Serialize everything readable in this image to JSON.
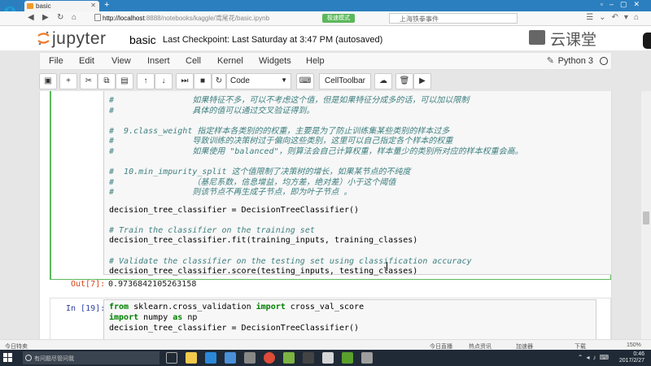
{
  "browser": {
    "tab_title": "basic",
    "url_host": "http://localhost",
    "url_path": ":8888/notebooks/kaggle/鸢尾花/basic.ipynb",
    "speed_badge": "极速模式",
    "search_placeholder": "上海铁拳事件"
  },
  "jupyter": {
    "logo_text": "jupyter",
    "notebook_name": "basic",
    "checkpoint": "Last Checkpoint: Last Saturday at 3:47 PM (autosaved)",
    "brand": "云课堂",
    "menu": [
      "File",
      "Edit",
      "View",
      "Insert",
      "Cell",
      "Kernel",
      "Widgets",
      "Help"
    ],
    "kernel_name": "Python 3",
    "cell_type": "Code",
    "celltoolbar": "CellToolbar"
  },
  "cell1": {
    "lines": [
      {
        "cls": "cm",
        "text": "#                如果特征不多，可以不考虑这个值，但是如果特征分成多的话，可以加以限制"
      },
      {
        "cls": "cm",
        "text": "#                具体的值可以通过交叉验证得到。"
      },
      {
        "cls": "",
        "text": ""
      },
      {
        "cls": "cm",
        "text": "#  9.class_weight 指定样本各类别的的权重，主要是为了防止训练集某些类别的样本过多"
      },
      {
        "cls": "cm",
        "text": "#                导致训练的决策树过于偏向这些类别，这里可以自己指定各个样本的权重"
      },
      {
        "cls": "cm",
        "text": "#                如果使用 \"balanced\"，则算法会自己计算权重，样本量少的类别所对应的样本权重会高。"
      },
      {
        "cls": "",
        "text": ""
      },
      {
        "cls": "cm",
        "text": "#  10.min_impurity_split 这个值限制了决策树的增长，如果某节点的不纯度"
      },
      {
        "cls": "cm",
        "text": "#                （基尼系数，信息增益，均方差，绝对差）小于这个阈值"
      },
      {
        "cls": "cm",
        "text": "#                则该节点不再生成子节点，即为叶子节点 。"
      },
      {
        "cls": "",
        "text": ""
      },
      {
        "cls": "",
        "text": "decision_tree_classifier = DecisionTreeClassifier()"
      },
      {
        "cls": "",
        "text": ""
      },
      {
        "cls": "cm",
        "text": "# Train the classifier on the training set"
      },
      {
        "cls": "",
        "text": "decision_tree_classifier.fit(training_inputs, training_classes)"
      },
      {
        "cls": "",
        "text": ""
      },
      {
        "cls": "cm",
        "text": "# Validate the classifier on the testing set using classification accuracy"
      },
      {
        "cls": "",
        "text": "decision_tree_classifier.score(testing_inputs, testing_classes)"
      }
    ]
  },
  "output1": {
    "prompt": "Out[7]:",
    "value": "0.9736842105263158"
  },
  "cell2": {
    "prompt": "In [19]:",
    "line1_kw1": "from",
    "line1_mid": " sklearn.cross_validation ",
    "line1_kw2": "import",
    "line1_end": " cross_val_score",
    "line2_kw1": "import",
    "line2_mid": " numpy ",
    "line2_kw2": "as",
    "line2_end": " np",
    "line3": "decision_tree_classifier = DecisionTreeClassifier()"
  },
  "statusbar": {
    "left": "今日特卖",
    "items": [
      "今日直播",
      "热点资讯",
      "加速器",
      "下载",
      "150%"
    ]
  },
  "taskbar": {
    "search_placeholder": "有问题尽管问我",
    "time": "0:46",
    "date": "2017/2/27"
  }
}
